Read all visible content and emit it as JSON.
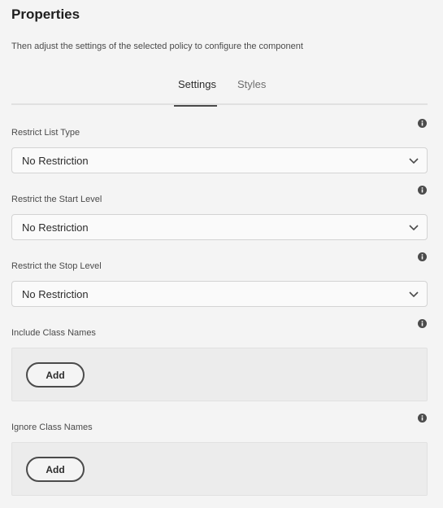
{
  "header": {
    "title": "Properties",
    "subtitle": "Then adjust the settings of the selected policy to configure the component"
  },
  "tabs": [
    {
      "label": "Settings",
      "active": true
    },
    {
      "label": "Styles",
      "active": false
    }
  ],
  "fields": {
    "restrict_list_type": {
      "label": "Restrict List Type",
      "value": "No Restriction"
    },
    "restrict_start_level": {
      "label": "Restrict the Start Level",
      "value": "No Restriction"
    },
    "restrict_stop_level": {
      "label": "Restrict the Stop Level",
      "value": "No Restriction"
    },
    "include_class_names": {
      "label": "Include Class Names",
      "add_label": "Add"
    },
    "ignore_class_names": {
      "label": "Ignore Class Names",
      "add_label": "Add"
    }
  },
  "icons": {
    "info": "info-icon",
    "dropdown": "chevron-down-icon"
  },
  "colors": {
    "background": "#f4f4f4",
    "tab_underline": "#4b4b4b",
    "button_border": "#4b4b4b"
  }
}
